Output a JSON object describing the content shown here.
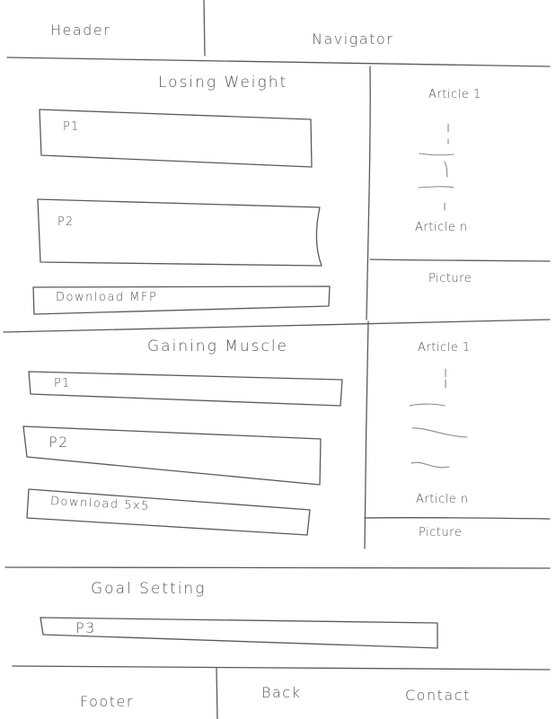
{
  "header": {
    "header_label": "Header",
    "navigator_label": "Navigator"
  },
  "section_1": {
    "title": "Losing Weight",
    "p1": "P1",
    "p2": "P2",
    "download": "Download MFP",
    "sidebar": {
      "article_first": "Article 1",
      "article_last": "Article n",
      "picture": "Picture"
    }
  },
  "section_2": {
    "title": "Gaining Muscle",
    "p1": "P1",
    "p2": "P2",
    "download": "Download 5x5",
    "sidebar": {
      "article_first": "Article 1",
      "article_last": "Article n",
      "picture": "Picture"
    }
  },
  "section_3": {
    "title": "Goal Setting",
    "p3": "P3"
  },
  "footer": {
    "footer_label": "Footer",
    "back_label": "Back",
    "contact_label": "Contact"
  }
}
